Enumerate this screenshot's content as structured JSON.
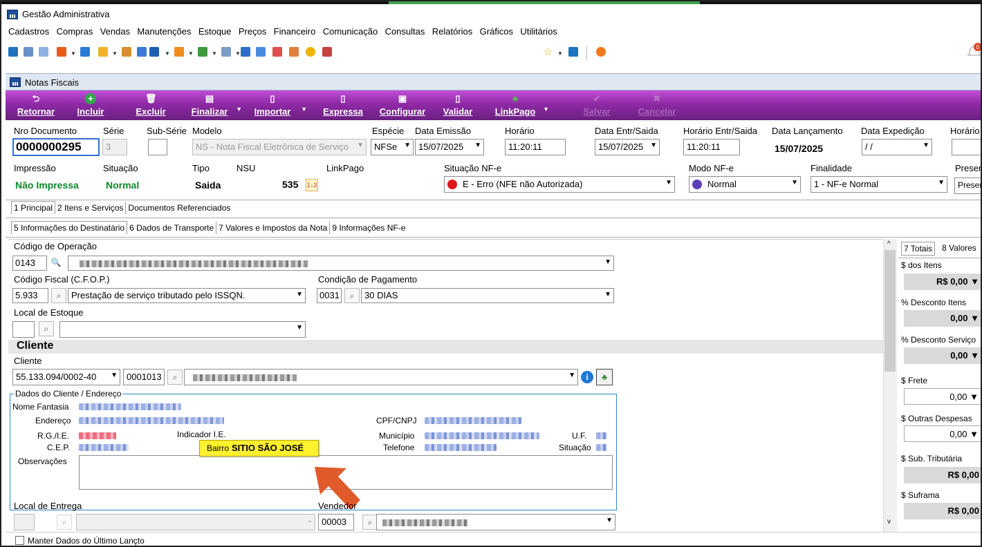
{
  "app": {
    "title": "Gestão Administrativa"
  },
  "menu": [
    "Cadastros",
    "Compras",
    "Vendas",
    "Manutenções",
    "Estoque",
    "Preços",
    "Financeiro",
    "Comunicação",
    "Consultas",
    "Relatórios",
    "Gráficos",
    "Utilitários"
  ],
  "window": {
    "title": "Notas Fiscais"
  },
  "actions": {
    "retornar": "Retornar",
    "incluir": "Incluir",
    "excluir": "Excluir",
    "finalizar": "Finalizar",
    "importar": "Importar",
    "expressa": "Expressa",
    "configurar": "Configurar",
    "validar": "Validar",
    "linkpago": "LinkPago",
    "salvar": "Salvar",
    "cancelar": "Cancelar"
  },
  "header": {
    "nro_documento_label": "Nro Documento",
    "nro_documento": "0000000295",
    "serie_label": "Série",
    "serie": "3",
    "subserie_label": "Sub-Série",
    "subserie": "",
    "modelo_label": "Modelo",
    "modelo": "NS - Nota Fiscal Eletrônica de Serviço",
    "especie_label": "Espécie",
    "especie": "NFSe",
    "data_emissao_label": "Data Emissão",
    "data_emissao": "15/07/2025",
    "horario_label": "Horário",
    "horario": "11:20:11",
    "data_entr_label": "Data Entr/Saida",
    "data_entr": "15/07/2025",
    "horario_entr_label": "Horário Entr/Saida",
    "horario_entr": "11:20:11",
    "data_lanc_label": "Data Lançamento",
    "data_lanc": "15/07/2025",
    "data_exped_label": "Data Expedição",
    "data_exped": " / /",
    "horario2_label": "Horário",
    "impressao_label": "Impressão",
    "impressao": "Não Impressa",
    "situacao_label": "Situação",
    "situacao": "Normal",
    "tipo_label": "Tipo",
    "tipo": "Saida",
    "nsu_label": "NSU",
    "nsu": "535",
    "linkpago_label": "LinkPago",
    "situacao_nfe_label": "Situação NF-e",
    "situacao_nfe": "E - Erro (NFE não Autorizada)",
    "modo_nfe_label": "Modo NF-e",
    "modo_nfe": "Normal",
    "finalidade_label": "Finalidade",
    "finalidade": "1 - NF-e Normal",
    "presenca_label": "Presen",
    "presenca": "Presen"
  },
  "tabs_main": [
    "1 Principal",
    "2 Itens e Serviços",
    "Documentos Referenciados"
  ],
  "tabs_sub": [
    "5 Informações do Destinatário",
    "6 Dados de Transporte",
    "7 Valores e Impostos da Nota",
    "9 Informações NF-e"
  ],
  "destinatario": {
    "codigo_operacao_label": "Código de Operação",
    "codigo_operacao": "0143",
    "cfop_label": "Código Fiscal (C.F.O.P.)",
    "cfop": "5.933",
    "cfop_desc": "Prestação de serviço tributado pelo ISSQN.",
    "condicao_label": "Condição de Pagamento",
    "condicao_cod": "0031",
    "condicao_desc": "30 DIAS",
    "local_estoque_label": "Local de Estoque",
    "cliente_section": "Cliente",
    "cliente_label": "Cliente",
    "cliente_doc": "55.133.094/0002-40",
    "cliente_cod": "0001013",
    "dados_cliente_label": "Dados do Cliente / Endereço",
    "nome_fantasia_label": "Nome Fantasia",
    "endereco_label": "Endereço",
    "cpf_cnpj_label": "CPF/CNPJ",
    "rg_ie_label": "R.G./I.E.",
    "indicador_ie_label": "Indicador I.E.",
    "municipio_label": "Município",
    "uf_label": "U.F.",
    "cep_label": "C.E.P.",
    "telefone_label": "Telefone",
    "situacao_label": "Situação",
    "observacoes_label": "Observações",
    "bairro_label": "Bairro",
    "bairro": "SITIO SÃO JOSÉ",
    "local_entrega_label": "Local de Entrega",
    "vendedor_label": "Vendedor",
    "vendedor_cod": "00003"
  },
  "totais": {
    "tabs": [
      "7 Totais",
      "8 Valores"
    ],
    "dos_itens_label": "$ dos Itens",
    "dos_itens": "R$ 0,00",
    "desconto_itens_label": "% Desconto Itens",
    "desconto_itens": "0,00",
    "desconto_servico_label": "% Desconto Serviço",
    "desconto_servico": "0,00",
    "frete_label": "$ Frete",
    "frete": "0,00",
    "outras_label": "$ Outras Despesas",
    "outras": "0,00",
    "sub_trib_label": "$ Sub. Tributária",
    "sub_trib": "R$ 0,00",
    "suframa_label": "$ Suframa",
    "suframa": "R$ 0,00"
  },
  "footer": {
    "manter": "Manter Dados do Último Lançto"
  },
  "colors": {
    "purple": "#8f2aa6",
    "tooltip": "#fff12e",
    "green": "#0a8a2a",
    "arrow": "#e05a2b"
  }
}
